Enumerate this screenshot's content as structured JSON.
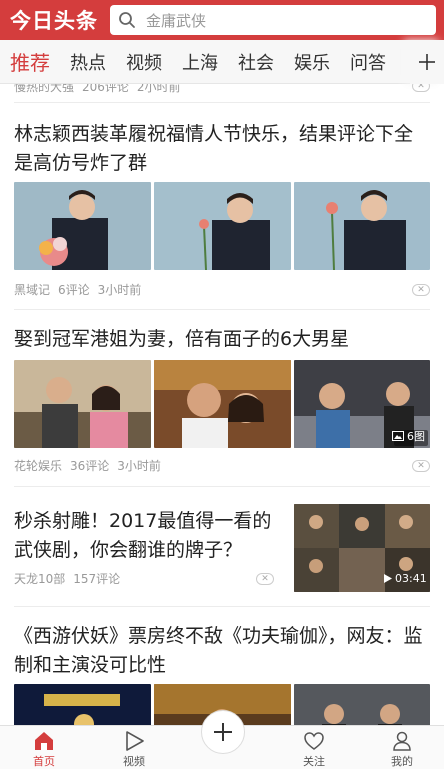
{
  "header": {
    "logo": "今日头条",
    "search_placeholder": "金庸武侠"
  },
  "tabs": [
    "推荐",
    "热点",
    "视频",
    "上海",
    "社会",
    "娱乐",
    "问答"
  ],
  "feed": {
    "prev": {
      "source": "慢热的大强",
      "comments": "206评论",
      "time": "2小时前"
    },
    "a1": {
      "title": "林志颖西装革履祝福情人节快乐，结果评论下全是高仿号炸了群",
      "source": "黑域记",
      "comments": "6评论",
      "time": "3小时前"
    },
    "a2": {
      "title": "娶到冠军港姐为妻，倍有面子的6大男星",
      "source": "花轮娱乐",
      "comments": "36评论",
      "time": "3小时前",
      "image_count": "6图"
    },
    "a3": {
      "title": "秒杀射雕！2017最值得一看的武侠剧，你会翻谁的牌子？",
      "source": "天龙10部",
      "comments": "157评论",
      "duration": "03:41"
    },
    "a4": {
      "title": "《西游伏妖》票房终不敌《功夫瑜伽》，网友：监制和主演没可比性"
    }
  },
  "bottom_nav": {
    "home": "首页",
    "video": "视频",
    "follow": "关注",
    "me": "我的"
  },
  "colors": {
    "brand": "#d43d3d",
    "meta": "#999999"
  }
}
